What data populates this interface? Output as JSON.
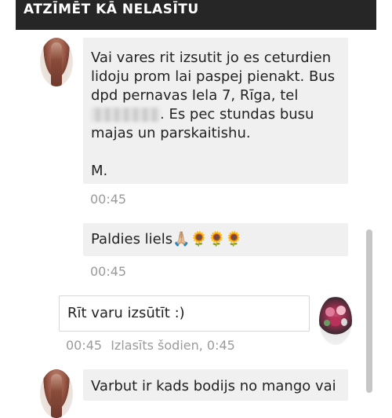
{
  "header": {
    "title": "ATZĪMĒT KĀ NELASĪTU"
  },
  "messages": [
    {
      "direction": "incoming",
      "lines": [
        "Vai vares rit izsutit jo es ceturdien",
        "lidoju prom lai paspej pienakt. Bus",
        "dpd pernavas Iela 7, Rīga, tel",
        ". Es pec stundas busu",
        "majas un parskaitishu.",
        "",
        "M."
      ],
      "time": "00:45"
    },
    {
      "direction": "incoming",
      "text": "Paldies liels🙏🏼🌻🌻🌻",
      "time": "00:45"
    },
    {
      "direction": "outgoing",
      "text": "Rīt varu izsūtīt :)",
      "time": "00:45",
      "status": "Izlasīts šodien, 0:45"
    },
    {
      "direction": "incoming",
      "text": "Varbut ir kads bodijs no mango vai"
    }
  ],
  "colors": {
    "header_bg": "#262626",
    "incoming_bubble": "#f0f0f0",
    "outgoing_border": "#d7d7d7",
    "timestamp": "#9a9a9a"
  }
}
